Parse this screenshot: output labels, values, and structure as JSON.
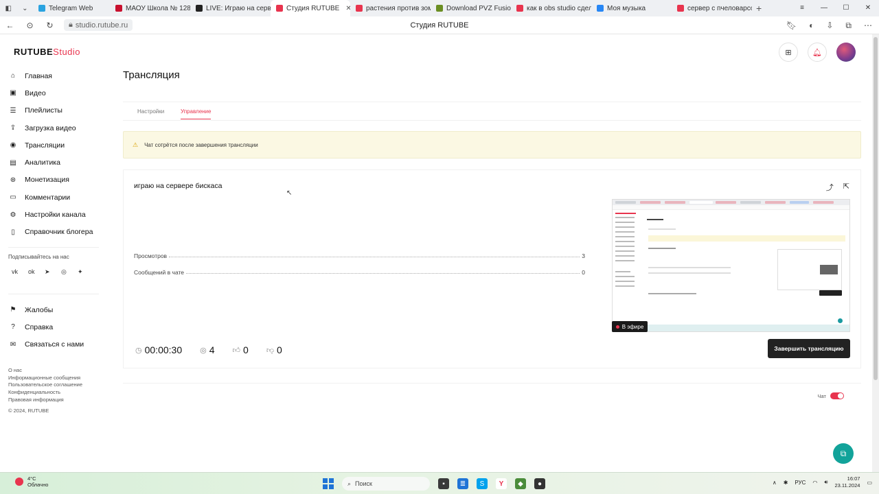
{
  "browser": {
    "tabs": [
      {
        "label": "Telegram Web",
        "color": "#2aa3e0",
        "active": false
      },
      {
        "label": "МАОУ Школа № 128",
        "color": "#c8102e",
        "active": false
      },
      {
        "label": "LIVE: Играю на серве",
        "color": "#222222",
        "active": false
      },
      {
        "label": "Студия RUTUBE",
        "color": "#e8344e",
        "active": true
      },
      {
        "label": "растения против зом",
        "color": "#e8344e",
        "active": false
      },
      {
        "label": "Download PVZ Fusion",
        "color": "#6b8e23",
        "active": false
      },
      {
        "label": "как в obs studio сдел",
        "color": "#e8344e",
        "active": false
      },
      {
        "label": "Моя музыка",
        "color": "#2787f5",
        "active": false
      },
      {
        "label": "сервер с пчеловарсо",
        "color": "#e8344e",
        "active": false
      }
    ],
    "url": "studio.rutube.ru",
    "page_title": "Студия RUTUBE"
  },
  "app": {
    "logo_main": "RUTUBE",
    "logo_sub": "Studio",
    "sidebar": {
      "items": [
        {
          "label": "Главная",
          "icon": "home-icon",
          "glyph": "⌂"
        },
        {
          "label": "Видео",
          "icon": "video-icon",
          "glyph": "▣"
        },
        {
          "label": "Плейлисты",
          "icon": "playlist-icon",
          "glyph": "☰"
        },
        {
          "label": "Загрузка видео",
          "icon": "upload-icon",
          "glyph": "⇪"
        },
        {
          "label": "Трансляции",
          "icon": "broadcast-icon",
          "glyph": "◉"
        },
        {
          "label": "Аналитика",
          "icon": "analytics-icon",
          "glyph": "▤"
        },
        {
          "label": "Монетизация",
          "icon": "money-icon",
          "glyph": "⊛"
        },
        {
          "label": "Комментарии",
          "icon": "comments-icon",
          "glyph": "▭"
        },
        {
          "label": "Настройки канала",
          "icon": "gear-icon",
          "glyph": "⚙"
        },
        {
          "label": "Справочник блогера",
          "icon": "book-icon",
          "glyph": "▯"
        }
      ],
      "subscribe_title": "Подписывайтесь на нас",
      "socials": [
        {
          "glyph": "vk",
          "icon": "vk-icon"
        },
        {
          "glyph": "ok",
          "icon": "ok-icon"
        },
        {
          "glyph": "➤",
          "icon": "telegram-icon"
        },
        {
          "glyph": "◎",
          "icon": "viber-icon"
        },
        {
          "glyph": "✦",
          "icon": "zen-icon"
        }
      ],
      "bottom_items": [
        {
          "label": "Жалобы",
          "icon": "flag-icon",
          "glyph": "⚑"
        },
        {
          "label": "Справка",
          "icon": "help-icon",
          "glyph": "?"
        },
        {
          "label": "Связаться с нами",
          "icon": "mail-icon",
          "glyph": "✉"
        }
      ],
      "footer_links": [
        "О нас",
        "Информационные сообщения",
        "Пользовательское соглашение",
        "Конфиденциальность",
        "Правовая информация",
        "© 2024, RUTUBE"
      ]
    },
    "page_title": "Трансляция",
    "page_tabs": {
      "settings": "Настройки",
      "manage": "Управление"
    },
    "warning_text": "Чат сотрётся после завершения трансляции",
    "stream": {
      "title": "играю на сервере бискаса",
      "views_label": "Просмотров",
      "views_value": "3",
      "messages_label": "Сообщений в чате",
      "messages_value": "0",
      "live_badge": "В эфире",
      "duration": "00:00:30",
      "viewers": "4",
      "likes": "0",
      "dislikes": "0",
      "end_button": "Завершить трансляцию"
    },
    "chat_toggle_label": "Чат"
  },
  "taskbar": {
    "temperature": "4°C",
    "weather": "Облачно",
    "search_placeholder": "Поиск",
    "language": "РУС",
    "time": "16:07",
    "date": "23.11.2024"
  }
}
